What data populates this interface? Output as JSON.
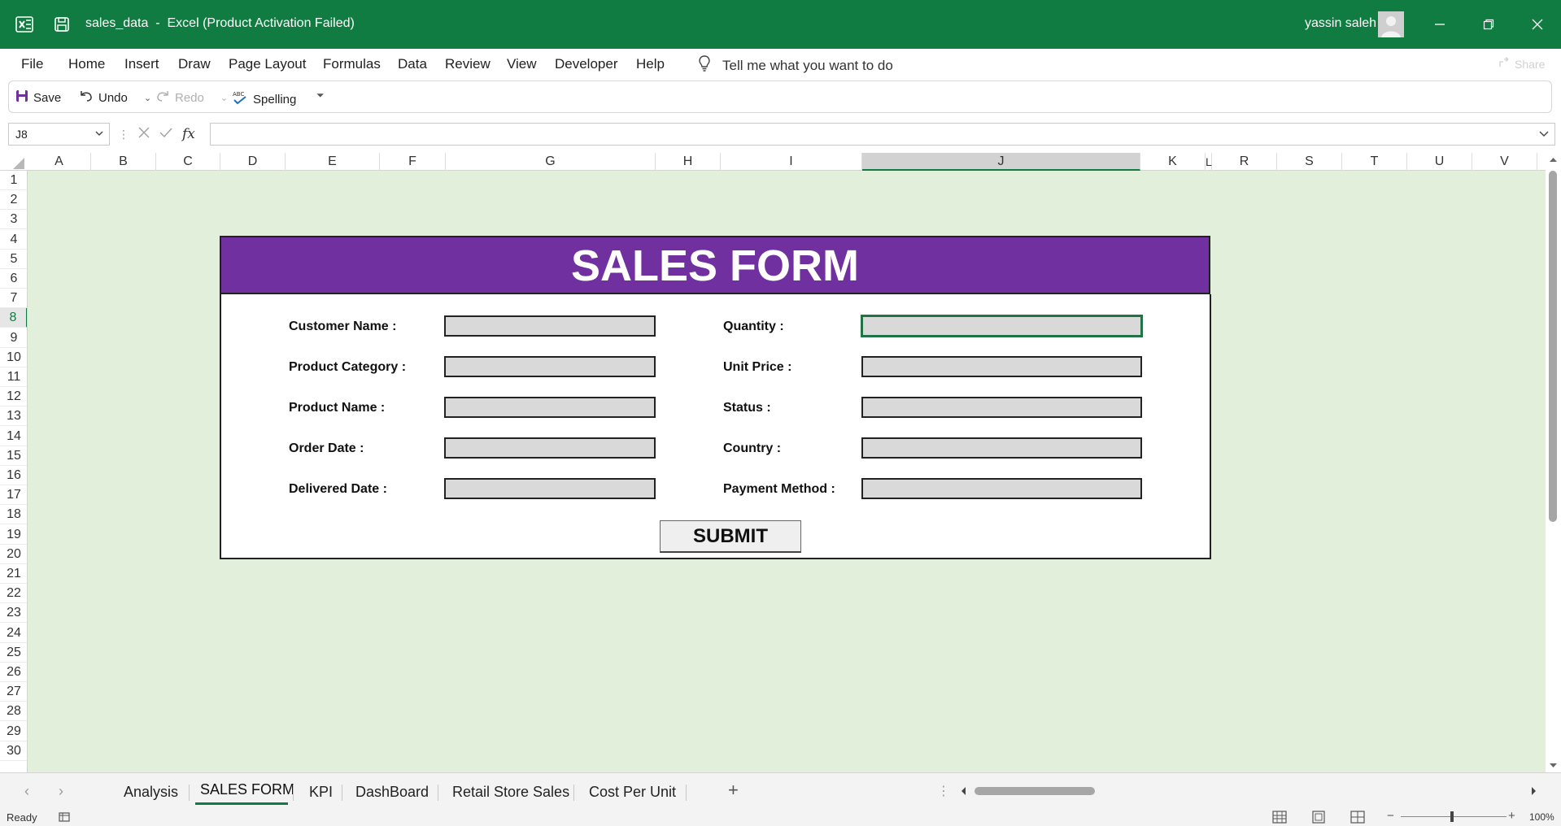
{
  "titlebar": {
    "file_name": "sales_data",
    "separator": "-",
    "app_status": "Excel (Product Activation Failed)",
    "user_name": "yassin saleh"
  },
  "menu": {
    "items": [
      "File",
      "Home",
      "Insert",
      "Draw",
      "Page Layout",
      "Formulas",
      "Data",
      "Review",
      "View",
      "Developer",
      "Help"
    ],
    "tell_me": "Tell me what you want to do",
    "share": "Share"
  },
  "qat": {
    "save": "Save",
    "undo": "Undo",
    "redo": "Redo",
    "spelling": "Spelling"
  },
  "formula_bar": {
    "name_box": "J8",
    "formula": ""
  },
  "grid": {
    "columns": [
      "A",
      "B",
      "C",
      "D",
      "E",
      "F",
      "G",
      "H",
      "I",
      "J",
      "K",
      "L",
      "R",
      "S",
      "T",
      "U",
      "V"
    ],
    "active_column": "J",
    "rows": [
      "1",
      "2",
      "3",
      "4",
      "5",
      "6",
      "7",
      "8",
      "9",
      "10",
      "11",
      "12",
      "13",
      "14",
      "15",
      "16",
      "17",
      "18",
      "19",
      "20",
      "21",
      "22",
      "23",
      "24",
      "25",
      "26",
      "27",
      "28",
      "29",
      "30"
    ],
    "active_row": "8"
  },
  "form": {
    "title": "SALES FORM",
    "left_labels": [
      "Customer Name :",
      "Product Category :",
      "Product Name :",
      "Order Date :",
      "Delivered Date :"
    ],
    "right_labels": [
      "Quantity :",
      "Unit Price :",
      "Status :",
      "Country :",
      "Payment Method :"
    ],
    "submit": "SUBMIT"
  },
  "sheets": {
    "tabs": [
      "Analysis",
      "SALES FORM",
      "KPI",
      "DashBoard",
      "Retail Store Sales",
      "Cost Per Unit"
    ],
    "active": "SALES FORM"
  },
  "status": {
    "ready": "Ready",
    "zoom": "100%"
  }
}
